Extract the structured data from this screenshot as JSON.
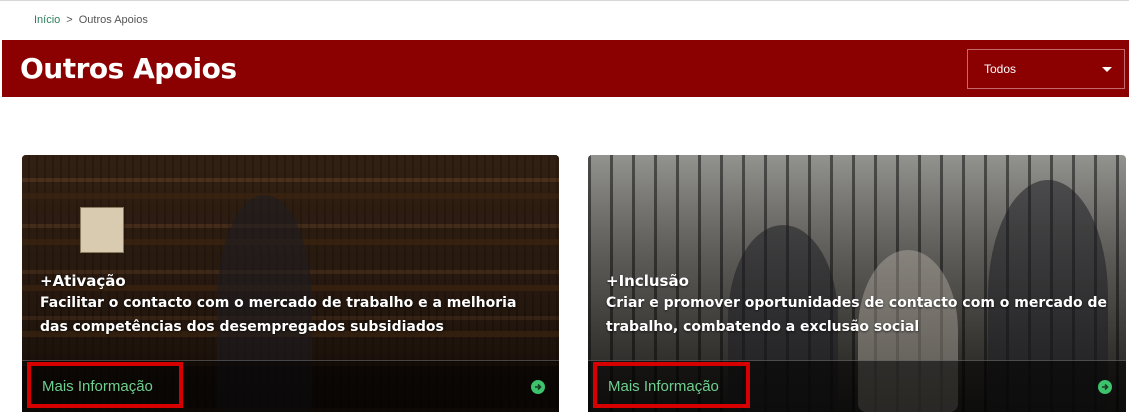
{
  "breadcrumb": {
    "home": "Início",
    "separator": ">",
    "current": "Outros Apoios"
  },
  "hero": {
    "title": "Outros Apoios",
    "filter": {
      "selected": "Todos"
    }
  },
  "cards": [
    {
      "title": "+Ativação",
      "description": "Facilitar o contacto com o mercado de trabalho e a melhoria das competências dos desempregados subsidiados",
      "link_label": "Mais Informação",
      "arrow_icon": "arrow-right-circle-icon"
    },
    {
      "title": "+Inclusão",
      "description": "Criar e promover oportunidades de contacto com o mercado de trabalho, combatendo a exclusão social",
      "link_label": "Mais Informação",
      "arrow_icon": "arrow-right-circle-icon"
    }
  ],
  "colors": {
    "brand": "#8b0000",
    "link": "#6fcf8f",
    "highlight": "#d60000",
    "breadcrumb_link": "#2e7d5b"
  }
}
